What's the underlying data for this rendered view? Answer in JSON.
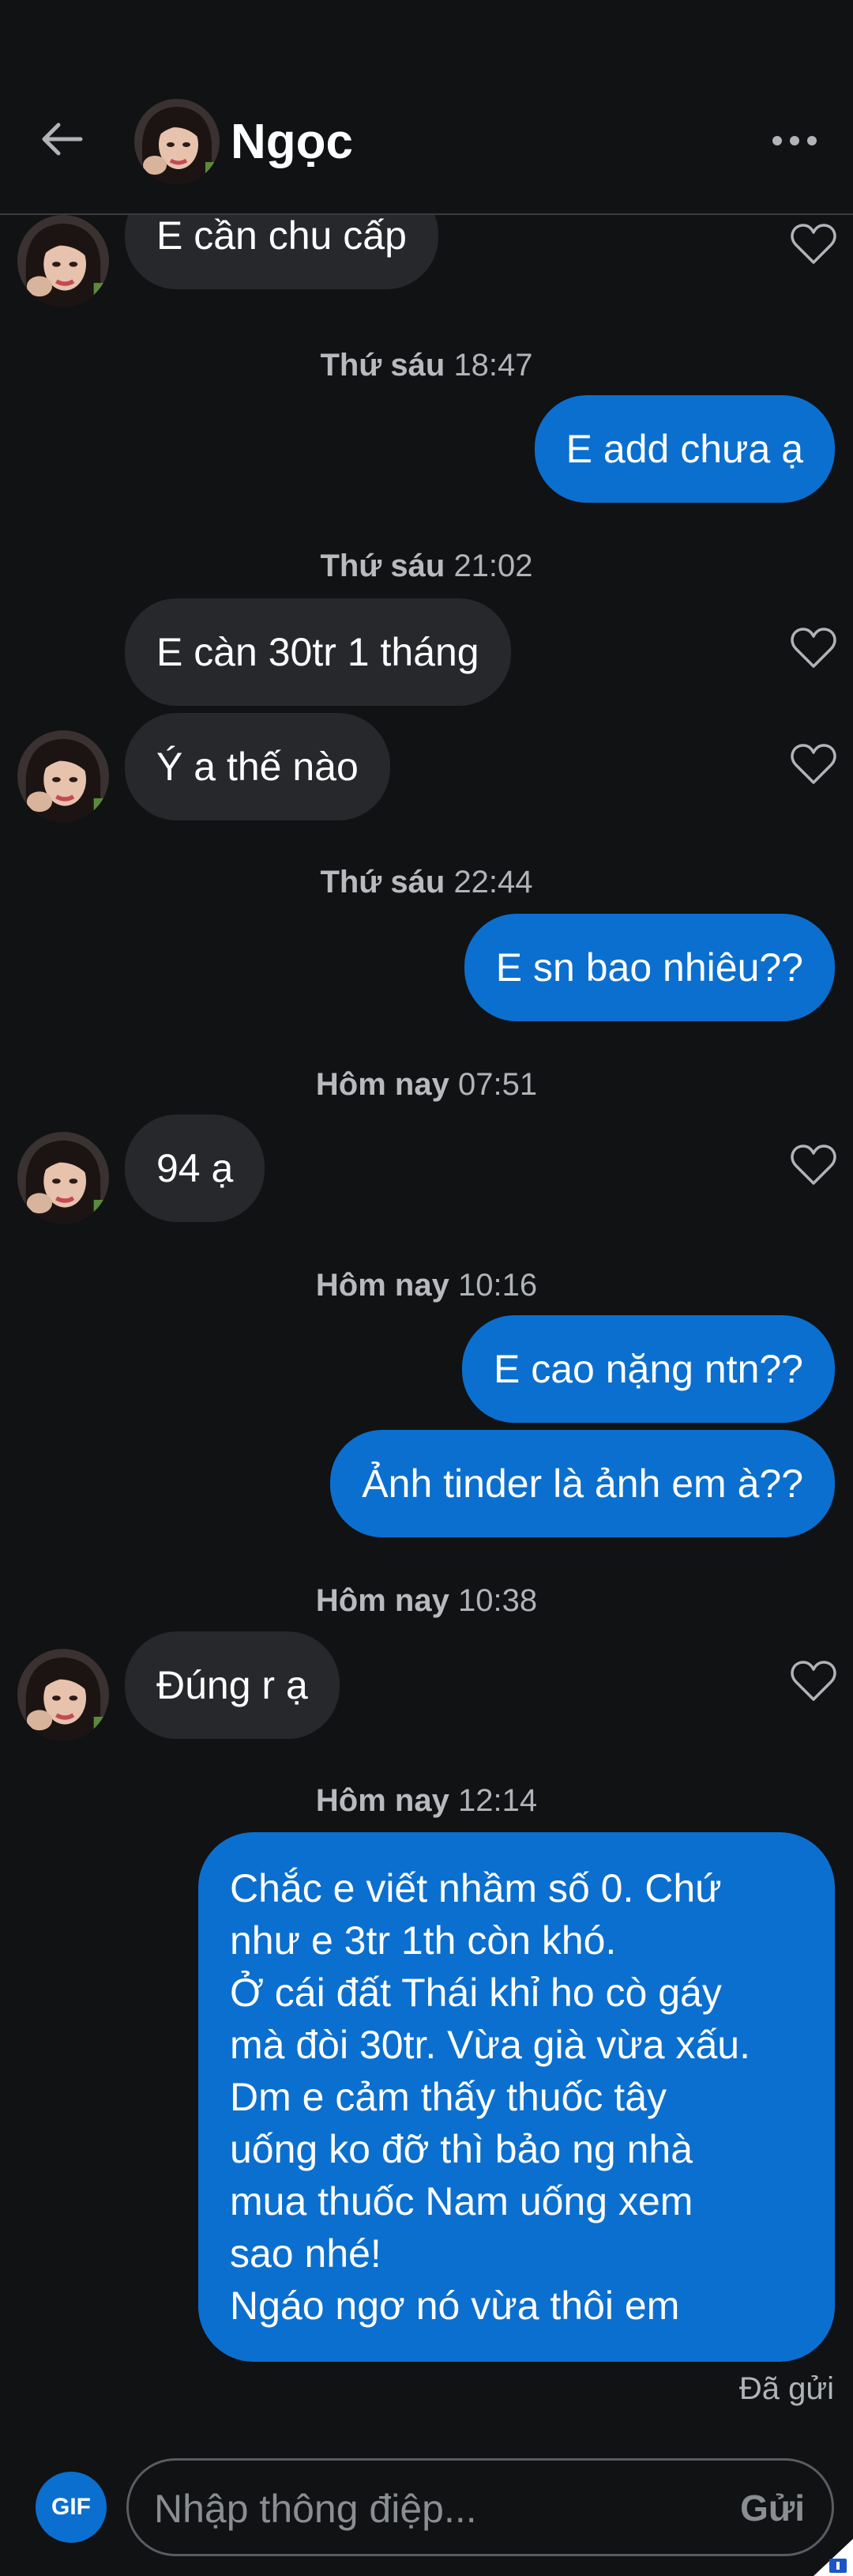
{
  "header": {
    "contact_name": "Ngọc"
  },
  "messages": [
    {
      "kind": "in",
      "text": "E cần chu cấp"
    },
    {
      "kind": "time",
      "day": "Thứ sáu",
      "clock": "18:47"
    },
    {
      "kind": "out",
      "text": "E add chưa ạ"
    },
    {
      "kind": "time",
      "day": "Thứ sáu",
      "clock": "21:02"
    },
    {
      "kind": "in",
      "text": "E càn 30tr 1 tháng"
    },
    {
      "kind": "in",
      "text": "Ý a thế nào"
    },
    {
      "kind": "time",
      "day": "Thứ sáu",
      "clock": "22:44"
    },
    {
      "kind": "out",
      "text": "E sn bao nhiêu??"
    },
    {
      "kind": "time",
      "day": "Hôm nay",
      "clock": "07:51"
    },
    {
      "kind": "in",
      "text": "94 ạ"
    },
    {
      "kind": "time",
      "day": "Hôm nay",
      "clock": "10:16"
    },
    {
      "kind": "out",
      "text": "E cao nặng ntn??"
    },
    {
      "kind": "out",
      "text": "Ảnh tinder là ảnh em à??"
    },
    {
      "kind": "time",
      "day": "Hôm nay",
      "clock": "10:38"
    },
    {
      "kind": "in",
      "text": "Đúng r ạ"
    },
    {
      "kind": "time",
      "day": "Hôm nay",
      "clock": "12:14"
    },
    {
      "kind": "out",
      "lines": [
        "Chắc e viết nhầm số 0. Chứ",
        "như e 3tr 1th còn khó.",
        "Ở cái đất Thái khỉ ho cò gáy",
        "mà đòi 30tr. Vừa già vừa xấu.",
        "Dm e cảm thấy thuốc tây",
        "uống ko đỡ thì bảo ng nhà",
        "mua thuốc Nam uống xem",
        "sao nhé!",
        "Ngáo ngơ nó vừa thôi em"
      ]
    }
  ],
  "status": {
    "delivered": "Đã gửi"
  },
  "composer": {
    "gif_label": "GIF",
    "placeholder": "Nhập thông điệp...",
    "send_label": "Gửi"
  },
  "colors": {
    "background": "#111214",
    "incoming_bubble": "#26282c",
    "outgoing_bubble": "#0b6fcf",
    "timestamp_text": "#b0b3b8"
  },
  "icons": {
    "back": "arrow-left-icon",
    "more": "more-dots-icon",
    "like": "heart-outline-icon",
    "gif": "gif-icon"
  }
}
